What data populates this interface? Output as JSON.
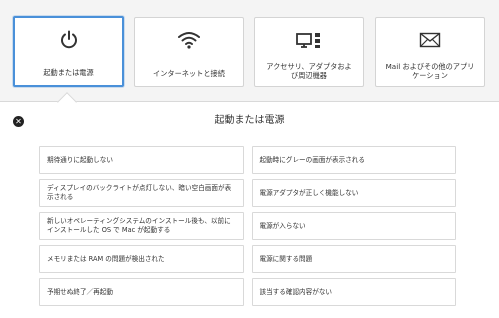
{
  "categories": [
    {
      "label": "起動または電源",
      "icon": "power-icon",
      "selected": true
    },
    {
      "label": "インターネットと接続",
      "icon": "wifi-icon",
      "selected": false
    },
    {
      "label": "アクセサリ、アダプタおよび周辺機器",
      "icon": "peripherals-icon",
      "selected": false
    },
    {
      "label": "Mail およびその他のアプリケーション",
      "icon": "mail-icon",
      "selected": false
    }
  ],
  "panel": {
    "title": "起動または電源",
    "close_icon": "close-icon"
  },
  "items": [
    [
      "期待通りに起動しない",
      "起動時にグレーの画面が表示される"
    ],
    [
      "ディスプレイのバックライトが点灯しない、暗い空白画面が表示される",
      "電源アダプタが正しく機能しない"
    ],
    [
      "新しいオペレーティングシステムのインストール後も、以前にインストールした OS で Mac が起動する",
      "電源が入らない"
    ],
    [
      "メモリまたは RAM の問題が検出された",
      "電源に関する問題"
    ],
    [
      "予期せぬ終了／再起動",
      "該当する確認内容がない"
    ]
  ],
  "colors": {
    "selected_border": "#4a90d9",
    "icon": "#333333"
  }
}
